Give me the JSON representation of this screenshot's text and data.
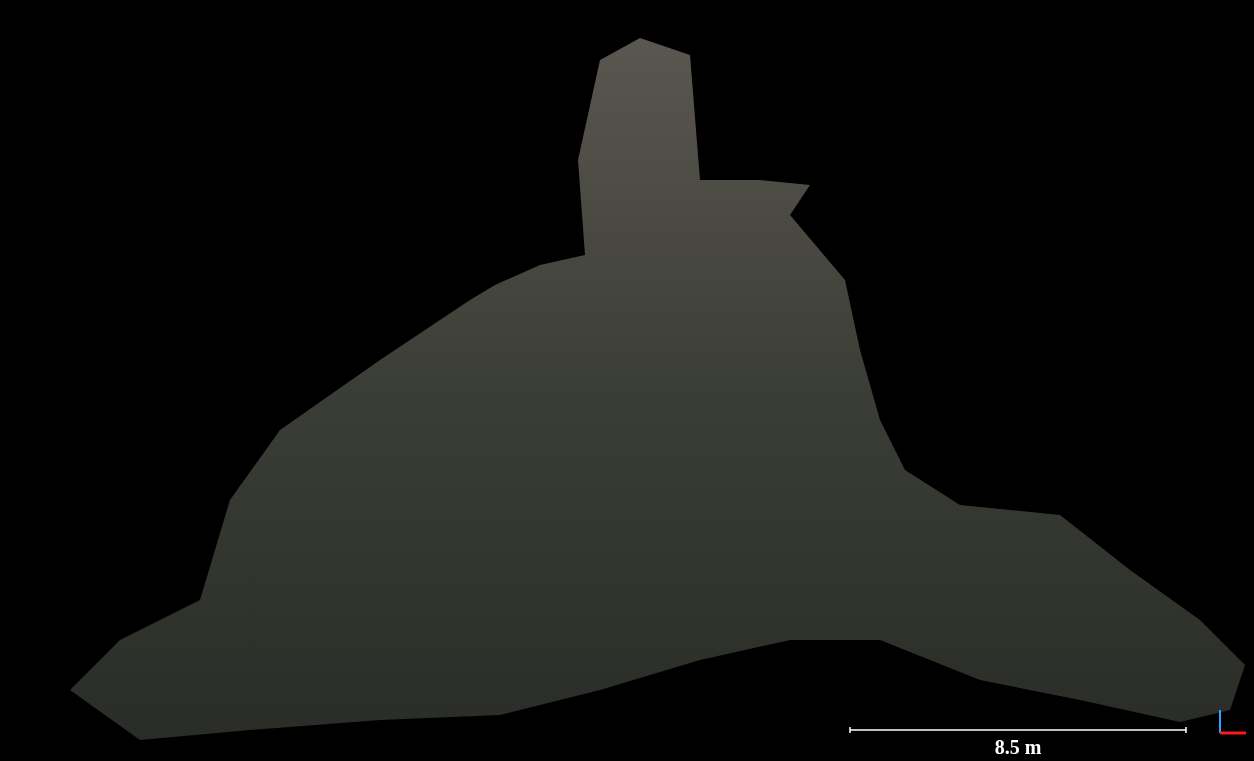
{
  "viewport": {
    "scale_bar": {
      "label": "8.5 m"
    }
  }
}
